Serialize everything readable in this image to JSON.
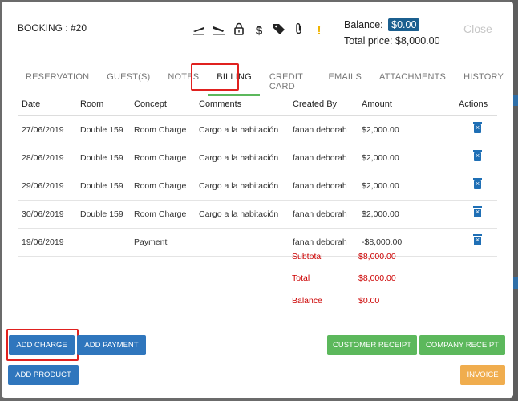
{
  "header": {
    "title": "BOOKING : #20",
    "close_label": "Close"
  },
  "balance": {
    "label": "Balance:",
    "value": "$0.00"
  },
  "total_price": "Total price: $8,000.00",
  "icons": [
    "airplane-departure-icon",
    "airplane-arrival-icon",
    "lock-icon",
    "dollar-icon",
    "tags-icon",
    "paperclip-icon",
    "exclamation-icon"
  ],
  "tabs": [
    {
      "label": "RESERVATION"
    },
    {
      "label": "GUEST(S)"
    },
    {
      "label": "NOTES"
    },
    {
      "label": "BILLING",
      "active": true
    },
    {
      "label": "CREDIT CARD"
    },
    {
      "label": "EMAILS"
    },
    {
      "label": "ATTACHMENTS"
    },
    {
      "label": "HISTORY"
    }
  ],
  "table": {
    "columns": [
      "Date",
      "Room",
      "Concept",
      "Comments",
      "Created By",
      "Amount",
      "Actions"
    ],
    "rows": [
      [
        "27/06/2019",
        "Double 159",
        "Room Charge",
        "Cargo a la habitación",
        "fanan deborah",
        "$2,000.00"
      ],
      [
        "28/06/2019",
        "Double 159",
        "Room Charge",
        "Cargo a la habitación",
        "fanan deborah",
        "$2,000.00"
      ],
      [
        "29/06/2019",
        "Double 159",
        "Room Charge",
        "Cargo a la habitación",
        "fanan deborah",
        "$2,000.00"
      ],
      [
        "30/06/2019",
        "Double 159",
        "Room Charge",
        "Cargo a la habitación",
        "fanan deborah",
        "$2,000.00"
      ],
      [
        "19/06/2019",
        "",
        "Payment",
        "",
        "fanan deborah",
        "-$8,000.00"
      ]
    ]
  },
  "summary": {
    "subtotal_label": "Subtotal",
    "subtotal_value": "$8,000.00",
    "total_label": "Total",
    "total_value": "$8,000.00",
    "balance_label": "Balance",
    "balance_value": "$0.00"
  },
  "buttons": {
    "add_charge": "ADD CHARGE",
    "add_payment": "ADD PAYMENT",
    "customer_receipt": "CUSTOMER RECEIPT",
    "company_receipt": "COMPANY RECEIPT",
    "add_product": "ADD PRODUCT",
    "invoice": "INVOICE"
  },
  "colors": {
    "accent_blue": "#2f76bd",
    "green": "#5cb85c",
    "orange": "#f0ad4e",
    "alert_red": "#cc0000",
    "highlight": "#e0211f"
  }
}
